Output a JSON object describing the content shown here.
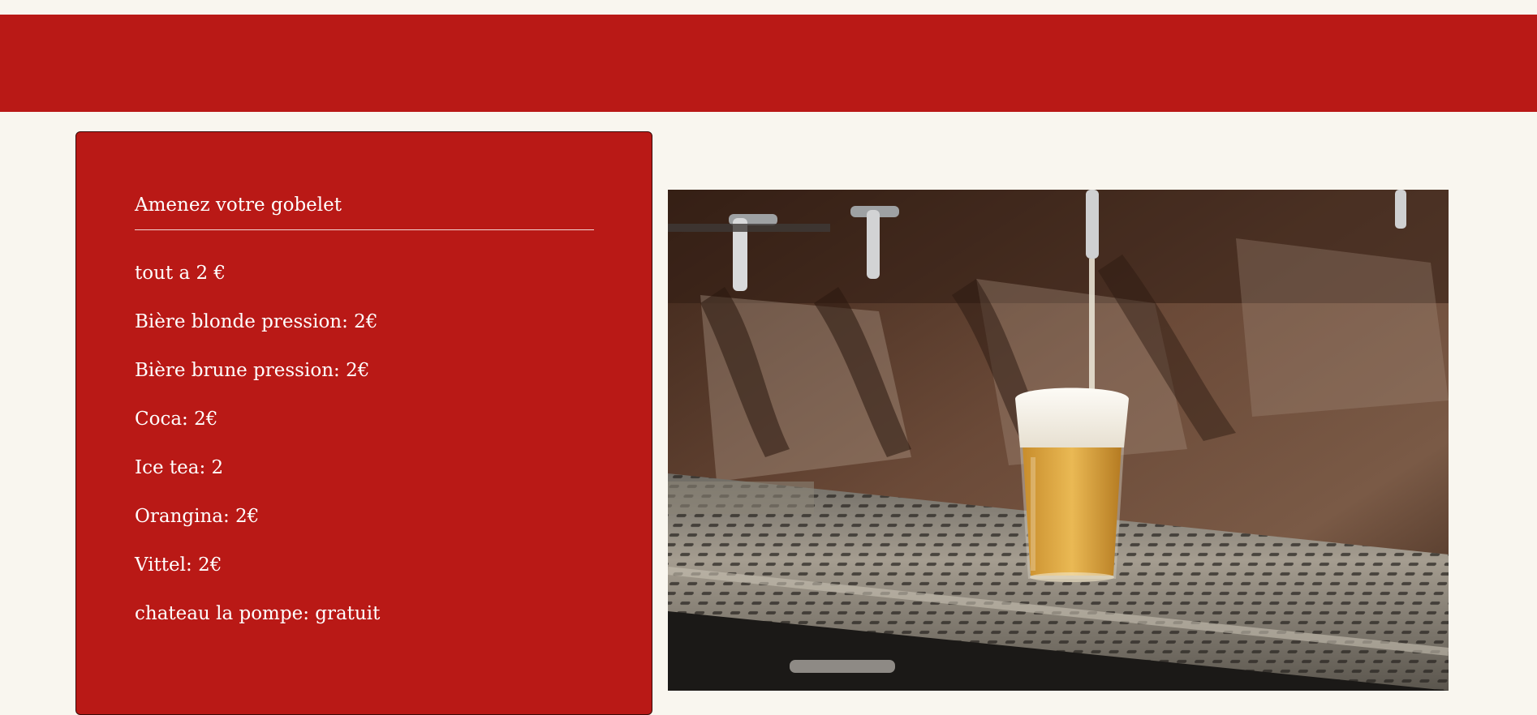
{
  "menu": {
    "heading": "Amenez votre gobelet",
    "items": [
      "tout a 2 €",
      "Bière blonde pression: 2€",
      "Bière brune pression: 2€",
      "Coca: 2€",
      "Ice tea: 2",
      "Orangina: 2€",
      "Vittel: 2€",
      "chateau la pompe: gratuit"
    ]
  },
  "photo": {
    "subject": "beer-tap-pouring-into-glass"
  },
  "colors": {
    "brand_red": "#b91916",
    "page_background": "#f9f6ef",
    "text": "#ffffff"
  }
}
